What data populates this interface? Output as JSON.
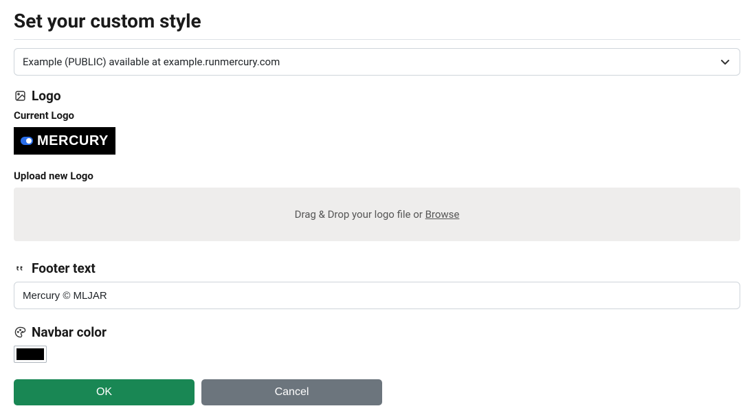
{
  "page": {
    "title": "Set your custom style"
  },
  "select": {
    "selected": "Example (PUBLIC) available at example.runmercury.com"
  },
  "logo": {
    "heading": "Logo",
    "current_label": "Current Logo",
    "brand_text": "MERCURY",
    "upload_label": "Upload new Logo",
    "dropzone_prefix": "Drag & Drop your logo file or ",
    "dropzone_browse": "Browse"
  },
  "footer": {
    "heading": "Footer text",
    "value": "Mercury © MLJAR"
  },
  "navbar": {
    "heading": "Navbar color",
    "color": "#000000"
  },
  "buttons": {
    "ok": "OK",
    "cancel": "Cancel"
  }
}
